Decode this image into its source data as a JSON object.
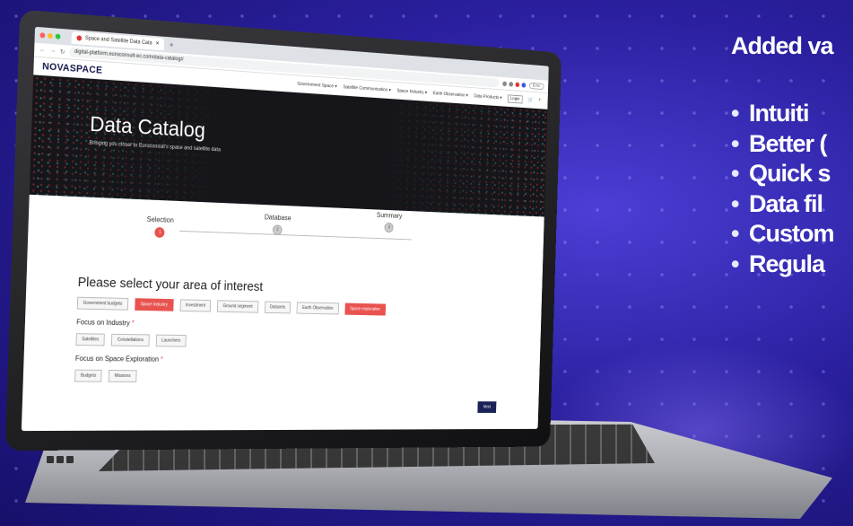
{
  "slide": {
    "heading": "Added va",
    "bullets": [
      "Intuiti",
      "Better (",
      "Quick s",
      "Data fil",
      "Custom",
      "Regula"
    ],
    "bullet_glyph": "•"
  },
  "browser": {
    "tab_title": "Space and Satellite Data Cata",
    "new_tab": "+",
    "url": "digital-platform.euroconsult-ec.com/data-catalog#",
    "profile_label": "Error"
  },
  "site": {
    "logo": "NOVASPACE",
    "nav": [
      "Government Space ▾",
      "Satellite Communication ▾",
      "Space Industry ▾",
      "Earth Observation ▾",
      "Data Products ▾"
    ],
    "login_label": "Login"
  },
  "hero": {
    "title": "Data Catalog",
    "subtitle": "Bringing you closer to Euroconsult's space and satellite data"
  },
  "stepper": {
    "steps": [
      {
        "label": "Selection",
        "num": "1"
      },
      {
        "label": "Database",
        "num": "2"
      },
      {
        "label": "Summary",
        "num": "3"
      }
    ]
  },
  "form": {
    "title": "Please select your area of interest",
    "areas": [
      "Government budgets",
      "Space industry",
      "Investment",
      "Ground segment",
      "Datasets",
      "Earth Observation",
      "Space exploration"
    ],
    "industry_title": "Focus on Industry",
    "industry_options": [
      "Satellites",
      "Constellations",
      "Launchers"
    ],
    "exploration_title": "Focus on Space Exploration",
    "exploration_options": [
      "Budgets",
      "Missions"
    ],
    "required_mark": "*",
    "next_label": "Next"
  }
}
